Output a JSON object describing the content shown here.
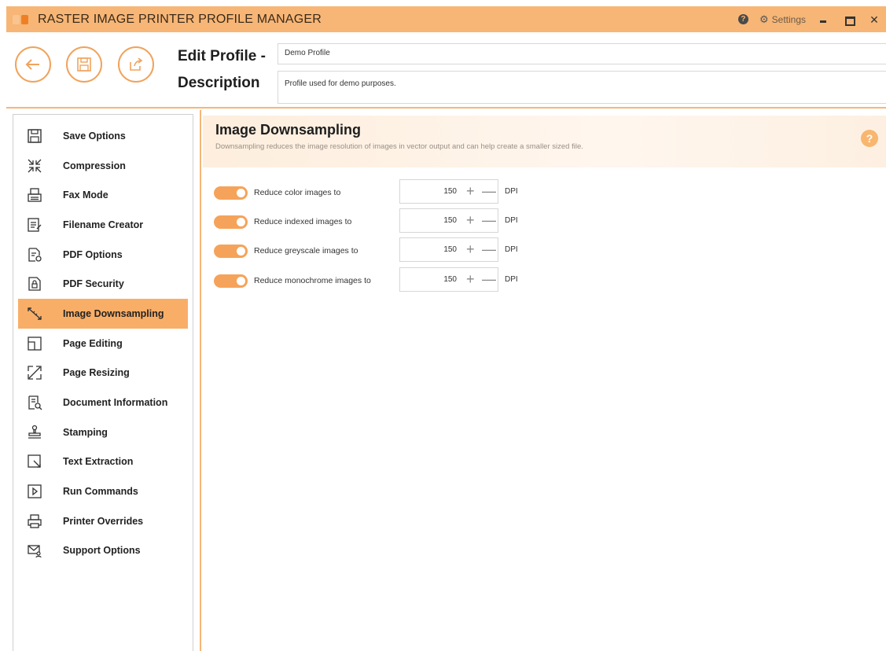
{
  "window": {
    "title": "RASTER IMAGE PRINTER PROFILE MANAGER",
    "settings_label": "Settings",
    "help_glyph": "?",
    "close_glyph": "✕"
  },
  "header": {
    "edit_label": "Edit Profile -",
    "profile_name": "Demo Profile",
    "description_label": "Description",
    "description_value": "Profile used for demo purposes."
  },
  "sidebar": {
    "items": [
      {
        "label": "Save Options",
        "icon": "save-icon"
      },
      {
        "label": "Compression",
        "icon": "compress-icon"
      },
      {
        "label": "Fax Mode",
        "icon": "fax-icon"
      },
      {
        "label": "Filename Creator",
        "icon": "filename-icon"
      },
      {
        "label": "PDF Options",
        "icon": "pdf-options-icon"
      },
      {
        "label": "PDF Security",
        "icon": "lock-icon"
      },
      {
        "label": "Image Downsampling",
        "icon": "downsample-icon",
        "active": true
      },
      {
        "label": "Page Editing",
        "icon": "page-edit-icon"
      },
      {
        "label": "Page Resizing",
        "icon": "resize-icon"
      },
      {
        "label": "Document Information",
        "icon": "document-info-icon"
      },
      {
        "label": "Stamping",
        "icon": "stamp-icon"
      },
      {
        "label": "Text Extraction",
        "icon": "text-extract-icon"
      },
      {
        "label": "Run Commands",
        "icon": "run-icon"
      },
      {
        "label": "Printer Overrides",
        "icon": "printer-icon"
      },
      {
        "label": "Support Options",
        "icon": "support-icon"
      }
    ]
  },
  "panel": {
    "title": "Image Downsampling",
    "description": "Downsampling reduces the image resolution of images in vector output and can help create a smaller sized file.",
    "help_glyph": "?",
    "options": [
      {
        "label": "Reduce color images to",
        "value": "150",
        "unit": "DPI",
        "enabled": true
      },
      {
        "label": "Reduce indexed images to",
        "value": "150",
        "unit": "DPI",
        "enabled": true
      },
      {
        "label": "Reduce greyscale images to",
        "value": "150",
        "unit": "DPI",
        "enabled": true
      },
      {
        "label": "Reduce monochrome images to",
        "value": "150",
        "unit": "DPI",
        "enabled": true
      }
    ]
  },
  "colors": {
    "accent": "#f7b676",
    "active_item": "#f9ae68",
    "toggle_on": "#f5a35a"
  }
}
